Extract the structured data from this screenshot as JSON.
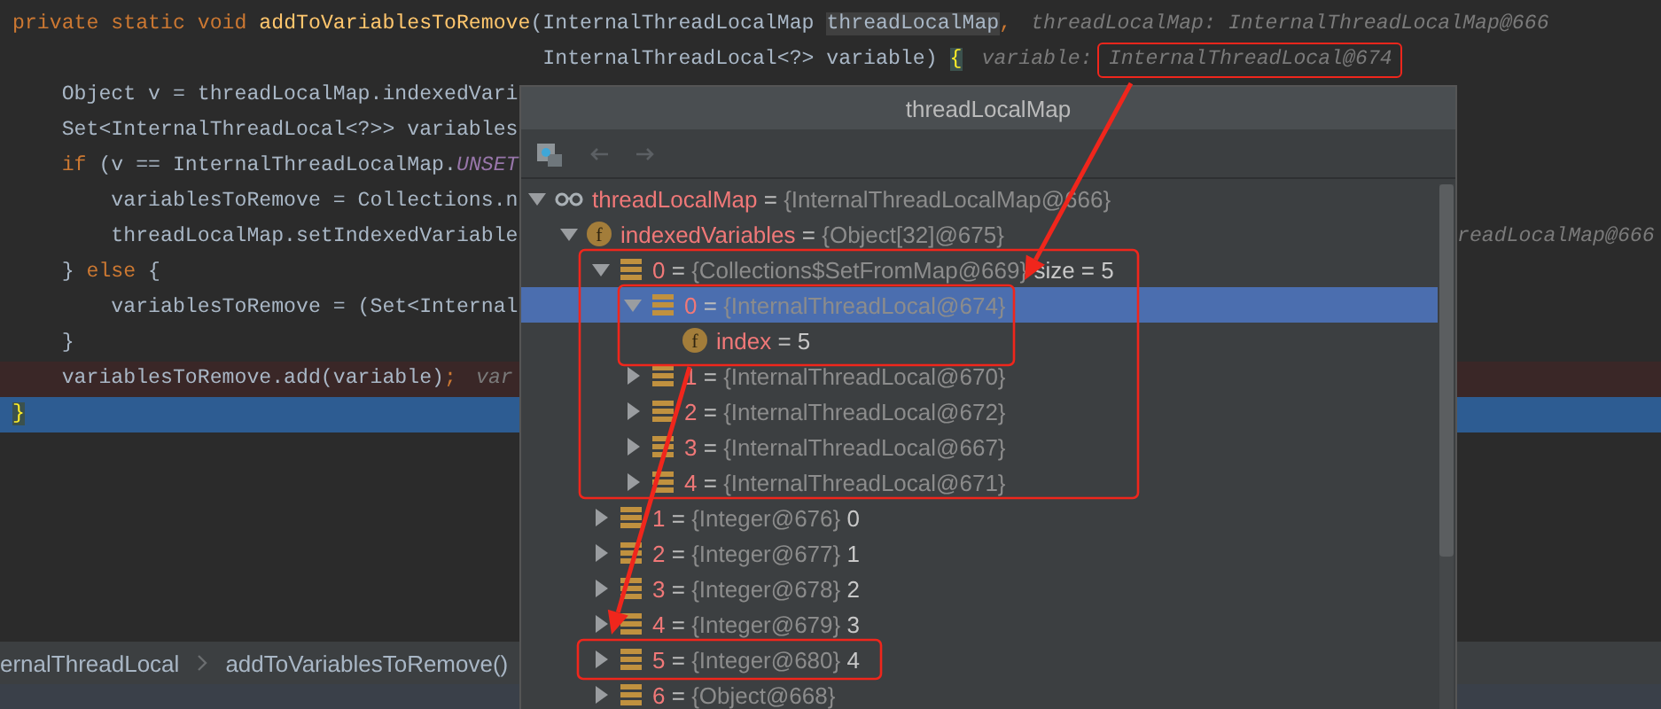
{
  "editor": {
    "lines": [
      {
        "breakpoint": false,
        "current": false,
        "code": [
          {
            "kind": "keyword",
            "text": "private static void "
          },
          {
            "kind": "method",
            "text": "addToVariablesToRemove"
          },
          {
            "kind": "plain",
            "text": "(InternalThreadLocalMap "
          },
          {
            "kind": "param",
            "text": "threadLocalMap"
          },
          {
            "kind": "keyword",
            "text": ","
          }
        ],
        "hint": "threadLocalMap: InternalThreadLocalMap@666"
      },
      {
        "breakpoint": false,
        "current": false,
        "code": [
          {
            "kind": "plain",
            "text": "                                           InternalThreadLocal<?> variable) "
          },
          {
            "kind": "brace",
            "text": "{"
          }
        ],
        "hint": "variable:",
        "boxed_hint": "InternalThreadLocal@674"
      },
      {
        "breakpoint": false,
        "current": false,
        "code": [
          {
            "kind": "plain",
            "text": "    Object v = threadLocalMap.indexedVari"
          }
        ]
      },
      {
        "breakpoint": false,
        "current": false,
        "code": [
          {
            "kind": "plain",
            "text": "    Set<InternalThreadLocal<?>> variables"
          }
        ]
      },
      {
        "breakpoint": false,
        "current": false,
        "code": [
          {
            "kind": "keyword",
            "text": "    if"
          },
          {
            "kind": "plain",
            "text": " (v == InternalThreadLocalMap."
          },
          {
            "kind": "constant",
            "text": "UNSET"
          }
        ]
      },
      {
        "breakpoint": false,
        "current": false,
        "code": [
          {
            "kind": "plain",
            "text": "        variablesToRemove = Collections.n"
          }
        ]
      },
      {
        "breakpoint": false,
        "current": false,
        "code": [
          {
            "kind": "plain",
            "text": "        threadLocalMap.setIndexedVariable"
          }
        ],
        "right_hint": "readLocalMap@666"
      },
      {
        "breakpoint": false,
        "current": false,
        "code": [
          {
            "kind": "plain",
            "text": "    } "
          },
          {
            "kind": "keyword",
            "text": "else"
          },
          {
            "kind": "plain",
            "text": " {"
          }
        ]
      },
      {
        "breakpoint": false,
        "current": false,
        "code": [
          {
            "kind": "plain",
            "text": "        variablesToRemove = (Set<Internal"
          }
        ]
      },
      {
        "breakpoint": false,
        "current": false,
        "code": [
          {
            "kind": "plain",
            "text": "    }"
          }
        ]
      },
      {
        "breakpoint": true,
        "current": false,
        "code": [
          {
            "kind": "plain",
            "text": "    variablesToRemove.add(variable)"
          },
          {
            "kind": "keyword",
            "text": ";"
          }
        ],
        "hint": "var"
      },
      {
        "breakpoint": false,
        "current": true,
        "code": [
          {
            "kind": "brace",
            "text": "}"
          }
        ]
      }
    ]
  },
  "breadcrumbs": [
    "ernalThreadLocal",
    "addToVariablesToRemove()"
  ],
  "popup": {
    "title": "threadLocalMap",
    "nav_buttons": [
      {
        "kind": "back",
        "disabled": true
      },
      {
        "kind": "forward",
        "disabled": true
      }
    ],
    "tree": [
      {
        "name": "threadLocalMap",
        "sep": "=",
        "ref": "{InternalThreadLocalMap@666}",
        "kind": "watch",
        "expanded": true,
        "selected": false,
        "children": [
          {
            "name": "indexedVariables",
            "sep": "=",
            "ref": "{Object[32]@675}",
            "kind": "field",
            "icon_letter": "f",
            "expanded": true,
            "selected": false,
            "children": [
              {
                "name": "0",
                "sep": "=",
                "ref": "{Collections$SetFromMap@669}",
                "value": "size = 5",
                "kind": "element",
                "expanded": true,
                "selected": false,
                "children": [
                  {
                    "name": "0",
                    "sep": "=",
                    "ref": "{InternalThreadLocal@674}",
                    "kind": "element",
                    "expanded": true,
                    "selected": true,
                    "children": [
                      {
                        "name": "index",
                        "sep": "=",
                        "value": "5",
                        "kind": "field",
                        "icon_letter": "f",
                        "selected": false
                      }
                    ]
                  },
                  {
                    "name": "1",
                    "sep": "=",
                    "ref": "{InternalThreadLocal@670}",
                    "kind": "element",
                    "expanded": false,
                    "selected": false
                  },
                  {
                    "name": "2",
                    "sep": "=",
                    "ref": "{InternalThreadLocal@672}",
                    "kind": "element",
                    "expanded": false,
                    "selected": false
                  },
                  {
                    "name": "3",
                    "sep": "=",
                    "ref": "{InternalThreadLocal@667}",
                    "kind": "element",
                    "expanded": false,
                    "selected": false
                  },
                  {
                    "name": "4",
                    "sep": "=",
                    "ref": "{InternalThreadLocal@671}",
                    "kind": "element",
                    "expanded": false,
                    "selected": false
                  }
                ]
              },
              {
                "name": "1",
                "sep": "=",
                "ref": "{Integer@676}",
                "value": "0",
                "kind": "element",
                "expanded": false,
                "selected": false
              },
              {
                "name": "2",
                "sep": "=",
                "ref": "{Integer@677}",
                "value": "1",
                "kind": "element",
                "expanded": false,
                "selected": false
              },
              {
                "name": "3",
                "sep": "=",
                "ref": "{Integer@678}",
                "value": "2",
                "kind": "element",
                "expanded": false,
                "selected": false
              },
              {
                "name": "4",
                "sep": "=",
                "ref": "{Integer@679}",
                "value": "3",
                "kind": "element",
                "expanded": false,
                "selected": false
              },
              {
                "name": "5",
                "sep": "=",
                "ref": "{Integer@680}",
                "value": "4",
                "kind": "element",
                "expanded": false,
                "selected": false
              },
              {
                "name": "6",
                "sep": "=",
                "ref": "{Object@668}",
                "kind": "element",
                "expanded": false,
                "selected": false
              }
            ]
          }
        ]
      }
    ]
  }
}
